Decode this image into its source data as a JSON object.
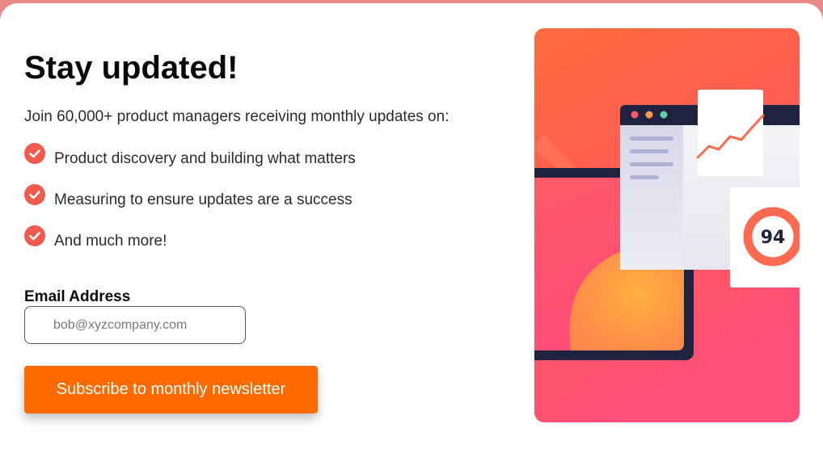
{
  "signup": {
    "title": "Stay updated!",
    "intro": "Join 60,000+ product managers receiving monthly updates on:",
    "benefits": [
      {
        "text": "Product discovery and building what matters",
        "icon": "check-circle-icon"
      },
      {
        "text": "Measuring to ensure updates are a success",
        "icon": "check-circle-icon"
      },
      {
        "text": "And much more!",
        "icon": "check-circle-icon"
      }
    ],
    "email": {
      "label": "Email Address",
      "placeholder": "bob@xyzcompany.com",
      "value": ""
    },
    "subscribe_label": "Subscribe to monthly newsletter"
  },
  "illustration": {
    "score": "94",
    "score_gauge_level": 0.94
  },
  "colors": {
    "background_frame": "#e98a88",
    "accent_orange": "#ff6a00",
    "check_red": "#f25a4e",
    "dark_navy": "#20233f"
  }
}
